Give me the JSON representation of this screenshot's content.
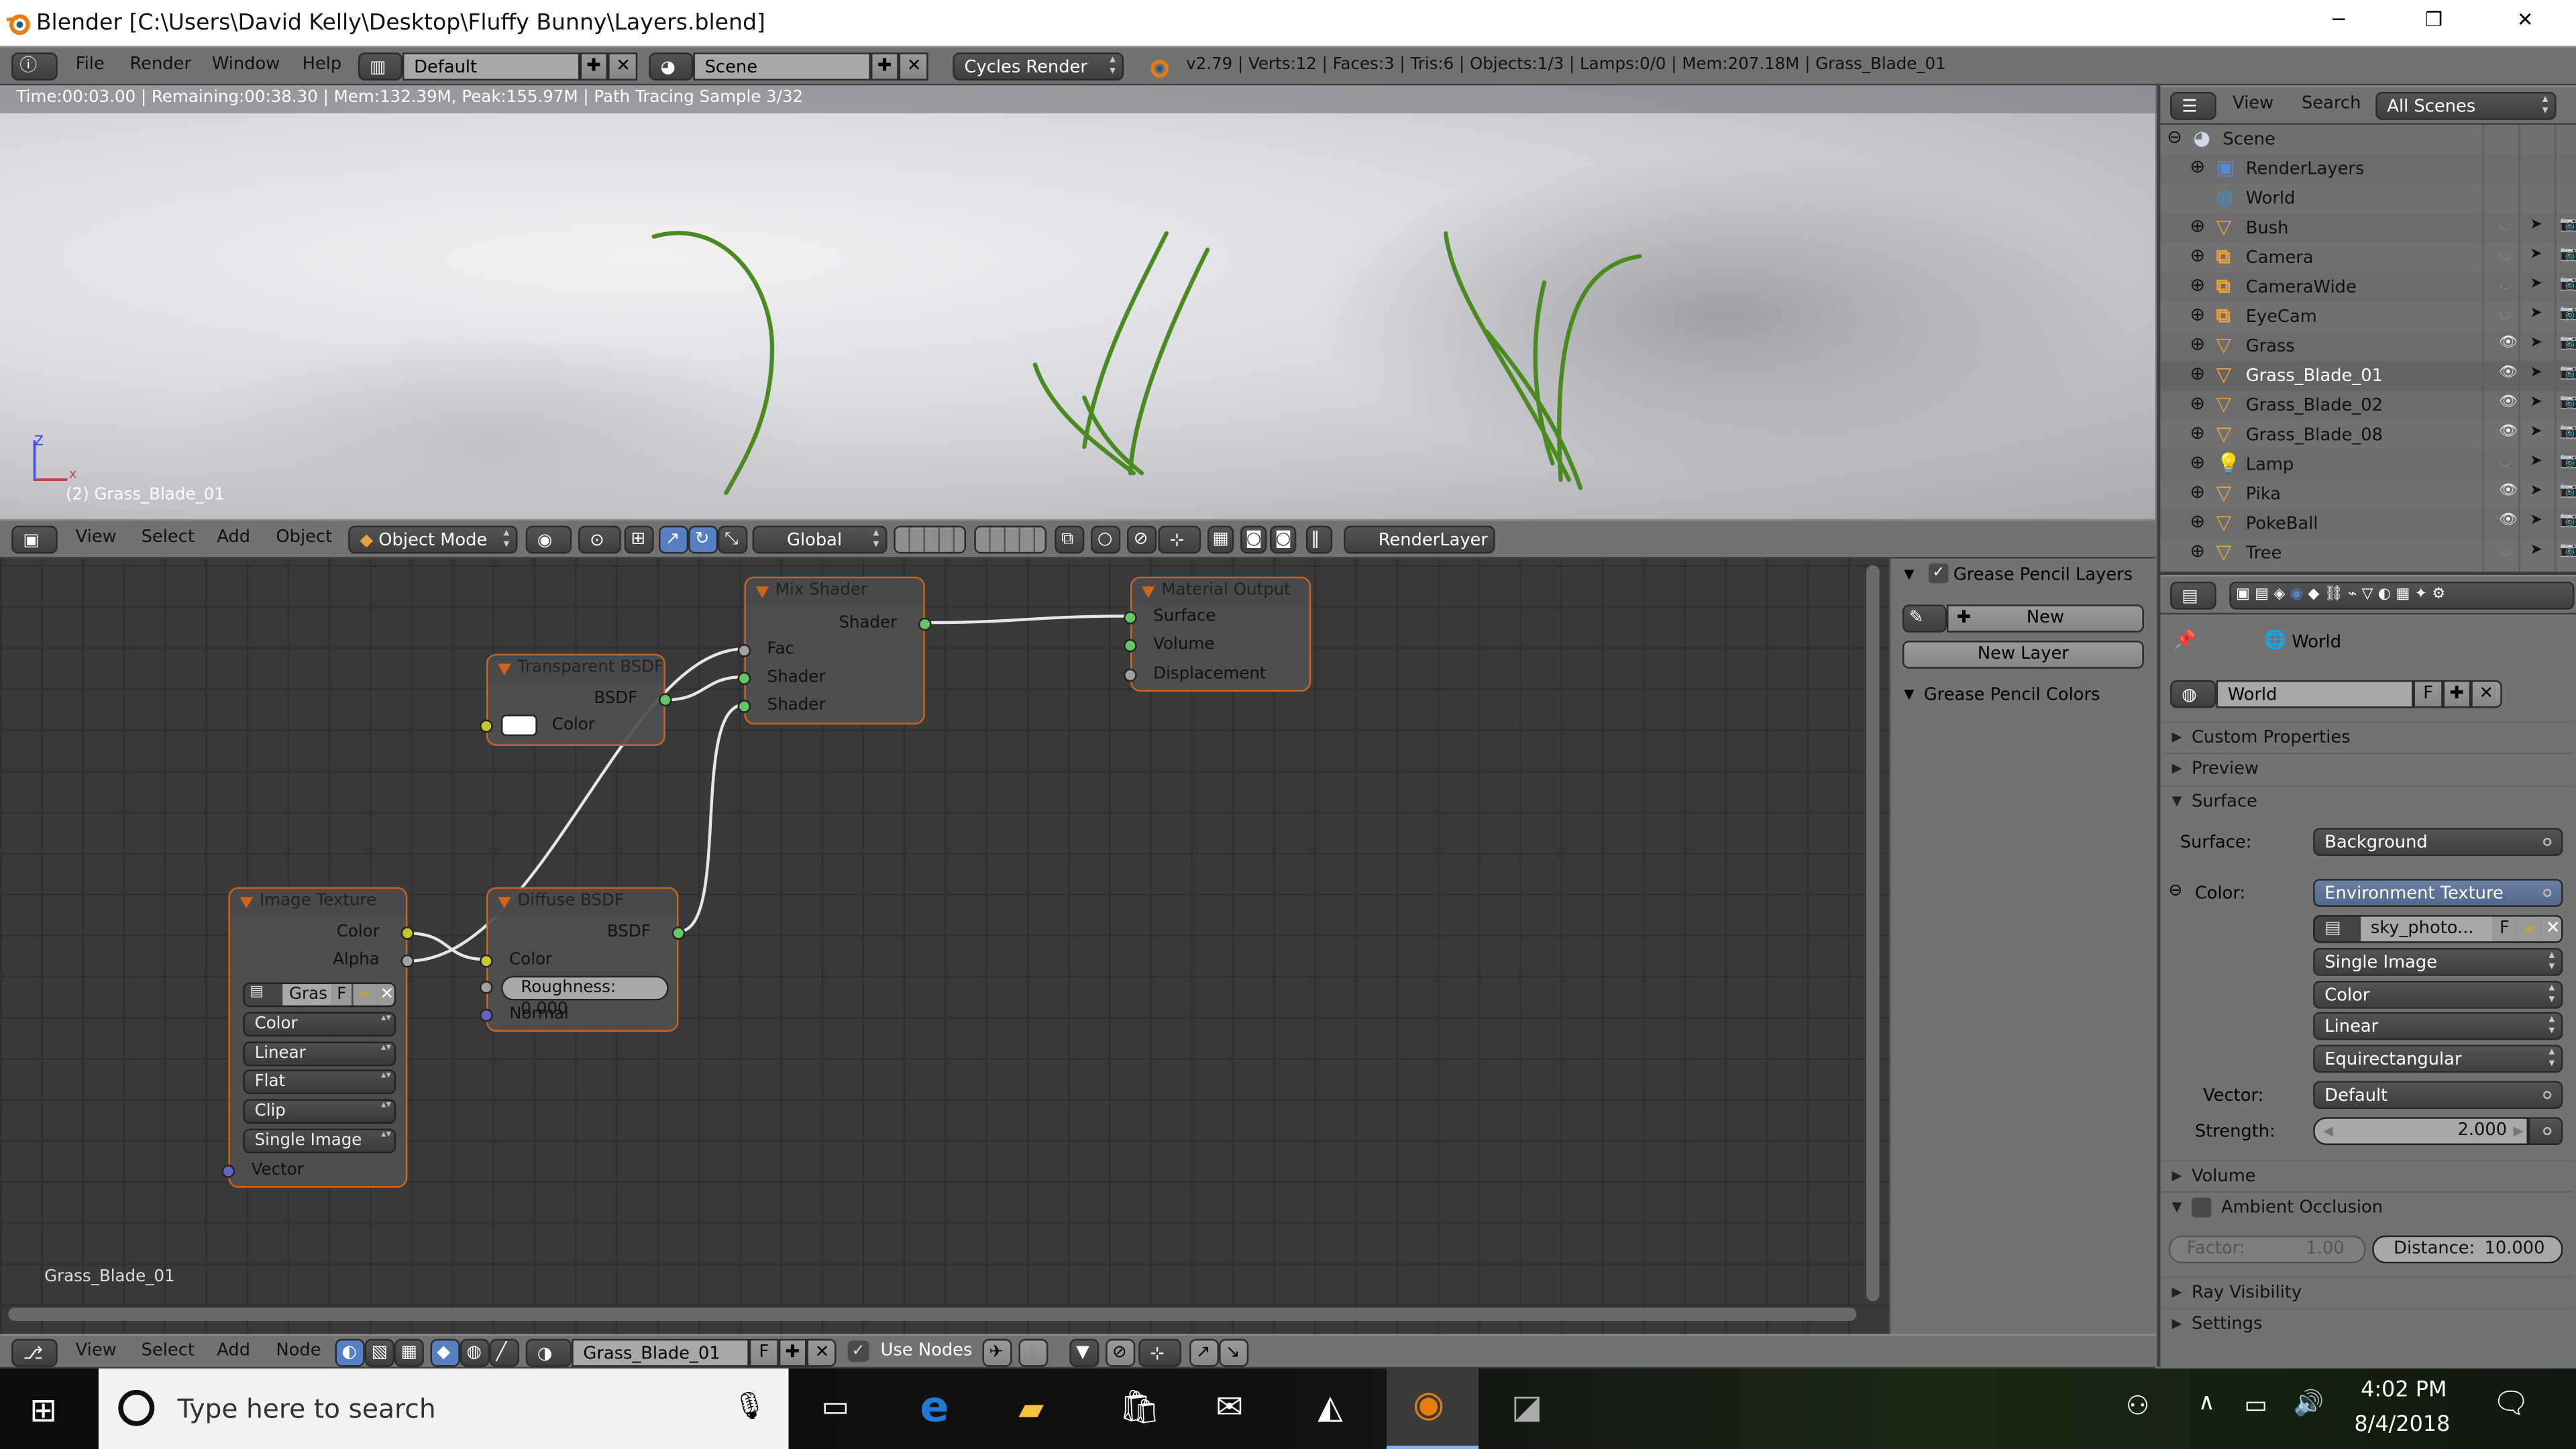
{
  "window": {
    "title": "Blender [C:\\Users\\David Kelly\\Desktop\\Fluffy Bunny\\Layers.blend]",
    "minimize": "─",
    "maximize": "❐",
    "close": "✕"
  },
  "info_header": {
    "menus": [
      "File",
      "Render",
      "Window",
      "Help"
    ],
    "screen_layout": "Default",
    "scene": "Scene",
    "render_engine": "Cycles Render",
    "stats": "v2.79 | Verts:12 | Faces:3 | Tris:6 | Objects:1/3 | Lamps:0/0 | Mem:207.18M | Grass_Blade_01"
  },
  "viewport": {
    "render_status": "Time:00:03.00 | Remaining:00:38.30 | Mem:132.39M, Peak:155.97M | Path Tracing Sample 3/32",
    "object_label": "(2) Grass_Blade_01",
    "axis_z": "Z",
    "axis_x": "x"
  },
  "view3d_header": {
    "menus": [
      "View",
      "Select",
      "Add",
      "Object"
    ],
    "mode": "Object Mode",
    "orientation": "Global",
    "render_layer": "RenderLayer"
  },
  "node_editor": {
    "active_label": "Grass_Blade_01",
    "nodes": {
      "mix_shader": {
        "title": "Mix Shader",
        "output": "Shader",
        "inputs": [
          "Fac",
          "Shader",
          "Shader"
        ]
      },
      "material_output": {
        "title": "Material Output",
        "inputs": [
          "Surface",
          "Volume",
          "Displacement"
        ]
      },
      "transparent_bsdf": {
        "title": "Transparent BSDF",
        "output": "BSDF",
        "input": "Color",
        "color": "#ffffff"
      },
      "image_texture": {
        "title": "Image Texture",
        "outputs": [
          "Color",
          "Alpha"
        ],
        "image": "Gras",
        "fake_user": "F",
        "color_space": "Color",
        "interpolation": "Linear",
        "projection": "Flat",
        "extension": "Clip",
        "source": "Single Image",
        "input": "Vector"
      },
      "diffuse_bsdf": {
        "title": "Diffuse BSDF",
        "output": "BSDF",
        "input_color": "Color",
        "roughness": "Roughness: 0.000",
        "input_normal": "Normal"
      }
    }
  },
  "grease_pencil": {
    "layers_title": "Grease Pencil Layers",
    "new": "New",
    "new_layer": "New Layer",
    "colors_title": "Grease Pencil Colors"
  },
  "node_header": {
    "menus": [
      "View",
      "Select",
      "Add",
      "Node"
    ],
    "material": "Grass_Blade_01",
    "fake_user": "F",
    "use_nodes": "Use Nodes",
    "use_nodes_checked": true
  },
  "outliner": {
    "menus": [
      "View",
      "Search"
    ],
    "filter": "All Scenes",
    "items": [
      {
        "name": "Scene",
        "type": "scene",
        "level": 0
      },
      {
        "name": "RenderLayers",
        "type": "renderlayers",
        "level": 1
      },
      {
        "name": "World",
        "type": "world",
        "level": 1
      },
      {
        "name": "Bush",
        "type": "mesh",
        "level": 1,
        "visible": false
      },
      {
        "name": "Camera",
        "type": "camera",
        "level": 1,
        "visible": false
      },
      {
        "name": "CameraWide",
        "type": "camera",
        "level": 1,
        "visible": false
      },
      {
        "name": "EyeCam",
        "type": "camera",
        "level": 1,
        "visible": false
      },
      {
        "name": "Grass",
        "type": "mesh",
        "level": 1,
        "visible": true
      },
      {
        "name": "Grass_Blade_01",
        "type": "mesh",
        "level": 1,
        "visible": true,
        "active": true
      },
      {
        "name": "Grass_Blade_02",
        "type": "mesh",
        "level": 1,
        "visible": true
      },
      {
        "name": "Grass_Blade_08",
        "type": "mesh",
        "level": 1,
        "visible": true
      },
      {
        "name": "Lamp",
        "type": "lamp",
        "level": 1,
        "visible": false
      },
      {
        "name": "Pika",
        "type": "mesh",
        "level": 1,
        "visible": true
      },
      {
        "name": "PokeBall",
        "type": "mesh",
        "level": 1,
        "visible": true
      },
      {
        "name": "Tree",
        "type": "mesh",
        "level": 1,
        "visible": false
      }
    ]
  },
  "properties": {
    "breadcrumb": "World",
    "world_name": "World",
    "fake_user": "F",
    "panels": {
      "custom_properties": "Custom Properties",
      "preview": "Preview",
      "surface": "Surface",
      "volume": "Volume",
      "ambient_occlusion": "Ambient Occlusion",
      "ray_visibility": "Ray Visibility",
      "settings": "Settings"
    },
    "surface_label": "Surface:",
    "surface_value": "Background",
    "color_label": "Color:",
    "color_value": "Environment Texture",
    "image": "sky_photo...",
    "image_source": "Single Image",
    "color_space": "Color",
    "interpolation": "Linear",
    "projection": "Equirectangular",
    "vector_label": "Vector:",
    "vector_value": "Default",
    "strength_label": "Strength:",
    "strength_value": "2.000",
    "ao_factor": "Factor:",
    "ao_factor_value": "1.00",
    "ao_distance": "Distance:",
    "ao_distance_value": "10.000"
  },
  "taskbar": {
    "search_placeholder": "Type here to search",
    "time": "4:02 PM",
    "date": "8/4/2018"
  },
  "colors": {
    "node_selected_border": "#d0641c",
    "socket_color": "#c7c729",
    "socket_shader": "#63c763",
    "socket_vector": "#6363c7",
    "selection_blue": "#5680c2"
  }
}
